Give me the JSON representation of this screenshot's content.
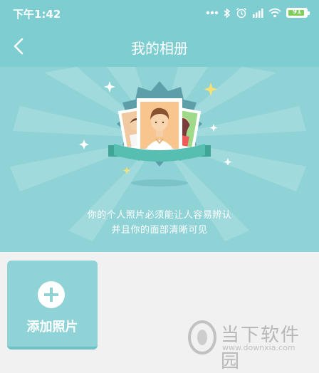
{
  "status_bar": {
    "time": "下午1:42",
    "battery_level": "91",
    "icons": [
      "more-dots-icon",
      "bluetooth-icon",
      "alarm-icon",
      "signal-icon",
      "wifi-icon",
      "battery-icon"
    ],
    "colors": {
      "background": "#7ecdd1",
      "battery_fill": "#7fce5b"
    }
  },
  "header": {
    "title": "我的相册",
    "back_icon": "chevron-left-icon"
  },
  "banner": {
    "line1": "你的个人照片必须能让人容易辨认",
    "line2": "并且你的面部清晰可见",
    "illustration": "photo-badge-icon",
    "colors": {
      "background": "#8fd3d7",
      "ribbon": "#4fb9ad",
      "badge": "#5aa0aa"
    }
  },
  "add_photo": {
    "label": "添加照片",
    "icon": "plus-circle-icon"
  },
  "watermark": {
    "name": "当下软件园",
    "url": "www.downxia.com"
  }
}
